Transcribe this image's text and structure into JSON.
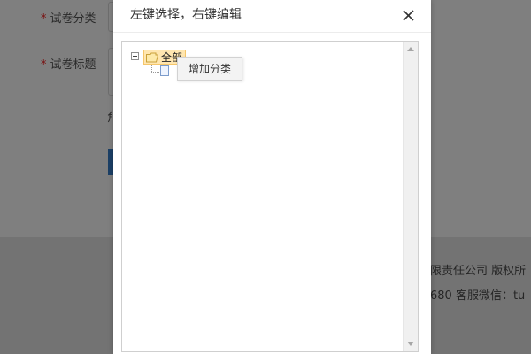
{
  "background": {
    "form": {
      "paper_category_label": "试卷分类",
      "paper_title_label": "试卷标题",
      "required_mark": "*",
      "partial_text": "角"
    },
    "footer": {
      "company_text": "限责任公司  版权所",
      "contact_text": "680  客服微信：tu"
    }
  },
  "dialog": {
    "title": "左键选择，右键编辑",
    "close_icon": "close-icon",
    "tree": {
      "root_label": "全部",
      "root_icon": "folder-open-icon",
      "child_icon": "file-icon"
    },
    "context_menu": {
      "items": [
        {
          "label": "增加分类"
        }
      ]
    }
  },
  "colors": {
    "overlay_dimmed_bg": "#7f7f7f",
    "selected_node_bg": "#ffe6b0",
    "selected_node_border": "#f5c66a",
    "context_menu_bg": "#f3f3f3"
  }
}
